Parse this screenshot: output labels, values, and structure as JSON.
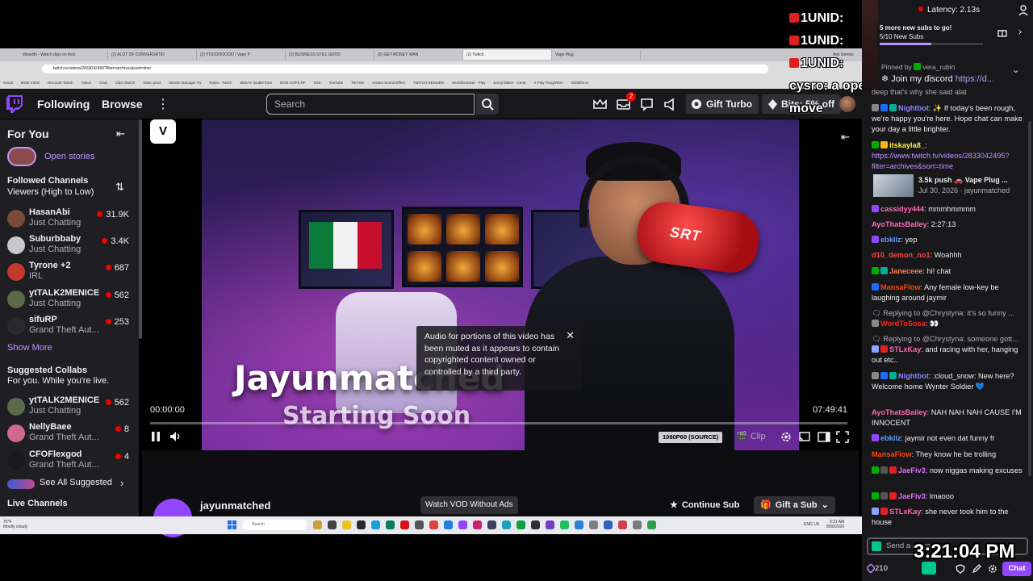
{
  "browser": {
    "tabs": [
      "sheedfn - Watch clips on Kick",
      "(2) ALOT OF CONVERSATIO",
      "(2) YOOOOOOOO | Vape P",
      "(2) BUSINESS STILL GOOD",
      "(2) GET MONEY WAN",
      "(2) Twitch",
      "Vape Plug"
    ],
    "url": "twitch.tv/videos/2833042495?filter=archives&sort=time",
    "bookmarks": [
      "Gmail",
      "MOD VIEW",
      "Discount Twitch",
      "Twitch",
      "Chat",
      "Clips Switch",
      "Video prod",
      "Stream Manager Tw",
      "Roles - Twitch",
      "6DDAY double from",
      "DIVE COPS RF",
      "Kick",
      "YouTube",
      "TIKTOK",
      "Instant Sound Effect",
      "TWITCH RESIZER",
      "WorldGuesser - Play",
      "Emoji Maker - Creat",
      "X Play ThugsNbrn",
      "GEMINI AI"
    ],
    "ask_gemini": "Ask Gemini"
  },
  "nav": {
    "following": "Following",
    "browse": "Browse",
    "search_placeholder": "Search",
    "notification_count": "2",
    "gift_turbo": "Gift Turbo",
    "bits": "Bits: 5% off"
  },
  "sidebar": {
    "for_you": "For You",
    "open_stories": "Open stories",
    "followed_heading": "Followed Channels",
    "followed_sort": "Viewers (High to Low)",
    "followed": [
      {
        "name": "HasanAbi",
        "category": "Just Chatting",
        "viewers": "31.9K",
        "color": "#7b4a3a"
      },
      {
        "name": "Suburbbaby",
        "category": "Just Chatting",
        "viewers": "3.4K",
        "color": "#c8c8c8"
      },
      {
        "name": "Tyrone +2",
        "category": "IRL",
        "viewers": "687",
        "color": "#c0392b"
      },
      {
        "name": "ytTALK2MENICE",
        "category": "Just Chatting",
        "viewers": "562",
        "color": "#5a6a4a"
      },
      {
        "name": "sifuRP",
        "category": "Grand Theft Aut...",
        "viewers": "253",
        "color": "#2a2a2a"
      }
    ],
    "show_more": "Show More",
    "suggested_heading": "Suggested Collabs",
    "suggested_sub": "For you. While you're live.",
    "suggested": [
      {
        "name": "ytTALK2MENICE",
        "category": "Just Chatting",
        "viewers": "562",
        "color": "#5a6a4a"
      },
      {
        "name": "NellyBaee",
        "category": "Grand Theft Aut...",
        "viewers": "8",
        "color": "#d06a8a"
      },
      {
        "name": "CFOFlexgod",
        "category": "Grand Theft Aut...",
        "viewers": "4",
        "color": "#1a1a1a"
      }
    ],
    "see_all": "See All Suggested",
    "live_channels": "Live Channels"
  },
  "player": {
    "badge": "V",
    "video_title_line1": "Jayunmatched",
    "video_title_line2": "Starting Soon",
    "key_fob_label": "SRT",
    "muted_message": "Audio for portions of this video has been muted as it appears to contain copyrighted content owned or controlled by a third party.",
    "time_current": "00:00:00",
    "time_total": "07:49:41",
    "progress": 0,
    "quality": "1080P60 (SOURCE)",
    "clip": "Clip"
  },
  "below_player": {
    "channel_name": "jayunmatched",
    "watch_vod": "Watch VOD Without Ads",
    "continue_sub": "Continue Sub",
    "gift_sub": "Gift a Sub"
  },
  "taskbar": {
    "weather_temp": "75°F",
    "weather_desc": "Mostly cloudy",
    "search": "Search",
    "time": "3:21 AM",
    "date": "8/06/2026",
    "lang": "ENG US"
  },
  "overlay_chat": [
    {
      "user": "1UNID:",
      "text": ""
    },
    {
      "user": "1UNID:",
      "text": ""
    },
    {
      "user": "1UNID:",
      "text": ""
    },
    {
      "user": "cysro:",
      "text": "a open rls might be the"
    },
    {
      "user": "",
      "text": "move"
    }
  ],
  "chat": {
    "latency": "Latency: 2.13s",
    "subs_title": "5 more new subs to go!",
    "subs_count": "5/10 New Subs",
    "subs_progress": 0.5,
    "pinned_by": "Pinned by",
    "pinned_user": "vera_rubin",
    "pinned_text": "Join my discord",
    "pinned_link": "https://d...",
    "messages": [
      {
        "badges": [
          "#7b7b7b"
        ],
        "user": "",
        "color": "#adadb8",
        "text": "deep that's why she said alat"
      },
      {
        "badges": [
          "#888",
          "#1f69ff",
          "#00ad96"
        ],
        "user": "Nightbot",
        "color": "#8a84ff",
        "text": ": ✨ If today's been rough, we're happy you're here. Hope chat can make your day a little brighter."
      },
      {
        "badges": [
          "#00ad03",
          "#ffb31a"
        ],
        "user": "itskayla8_",
        "color": "#ffeb3b",
        "text": ":"
      },
      {
        "badges": [],
        "user": "",
        "color": "#bf94ff",
        "text": "https://www.twitch.tv/videos/2833042495?filter=archives&sort=time"
      },
      {
        "badges": [
          "#9147ff"
        ],
        "user": "cassidyy444",
        "color": "#ff69b4",
        "text": ": mmmhmmmm"
      },
      {
        "badges": [],
        "user": "AyoThatsBailey",
        "color": "#ff69b4",
        "text": ": 2:27:13"
      },
      {
        "badges": [
          "#9147ff"
        ],
        "user": "ebkliz",
        "color": "#5b9bff",
        "text": ": yep"
      },
      {
        "badges": [],
        "user": "d10_demon_no1",
        "color": "#ff4040",
        "text": ": Woahhh"
      },
      {
        "badges": [
          "#00ad03",
          "#00ad96"
        ],
        "user": "Janeceee",
        "color": "#ff7f50",
        "text": ": hi! chat"
      },
      {
        "badges": [
          "#1f69ff"
        ],
        "user": "MansaFlow",
        "color": "#ff4500",
        "text": ": Any female low-key be laughing around jaymir"
      },
      {
        "badges": [],
        "user": "",
        "color": "#adadb8",
        "text": "Replying to @Chrystyna: it's so funny ..."
      },
      {
        "badges": [
          "#888"
        ],
        "user": "WordToSosa",
        "color": "#ff2020",
        "text": ": 👀"
      },
      {
        "badges": [],
        "user": "",
        "color": "#adadb8",
        "text": "Replying to @Chrystyna: someone gott..."
      },
      {
        "badges": [
          "#8aa4ff",
          "#e02020"
        ],
        "user": "STLxKay",
        "color": "#ff69b4",
        "text": ": and racing with her, hanging out etc.."
      },
      {
        "badges": [
          "#888",
          "#1f69ff",
          "#00ad96"
        ],
        "user": "Nightbot",
        "color": "#8a84ff",
        "text": ": :cloud_snow: New here? Welcome home Wynter Soldier 💙"
      },
      {
        "badges": [],
        "user": "AyoThatsBailey",
        "color": "#ff69b4",
        "text": ": NAH NAH NAH CAUSE I'M INNOCENT"
      },
      {
        "badges": [
          "#9147ff"
        ],
        "user": "ebkliz",
        "color": "#5b9bff",
        "text": ": jaymir not even dat funny fr"
      },
      {
        "badges": [],
        "user": "MansaFlow",
        "color": "#ff4500",
        "text": ": They know he be trolling"
      },
      {
        "badges": [
          "#00ad03",
          "#555",
          "#e02020"
        ],
        "user": "JaeFiv3",
        "color": "#e06cff",
        "text": ": now niggas making excuses"
      },
      {
        "badges": [
          "#00ad03",
          "#555",
          "#e02020"
        ],
        "user": "JaeFiv3",
        "color": "#e06cff",
        "text": ": lmaooo"
      },
      {
        "badges": [
          "#8aa4ff",
          "#e02020"
        ],
        "user": "STLxKay",
        "color": "#ff69b4",
        "text": ": she never took him to the house"
      }
    ],
    "vod_title": "3.5k push 🚗 Vape Plug ...",
    "vod_date": "Jul 30, 2026 · jayunmatched",
    "input_placeholder": "Send a message",
    "points": "210",
    "chat_button": "Chat"
  },
  "overlay_clock": "3:21:04 PM",
  "colors": {
    "twitch_purple": "#9147ff",
    "link_purple": "#bf94ff",
    "live_red": "#eb0400",
    "chat_bg": "#18181b"
  }
}
